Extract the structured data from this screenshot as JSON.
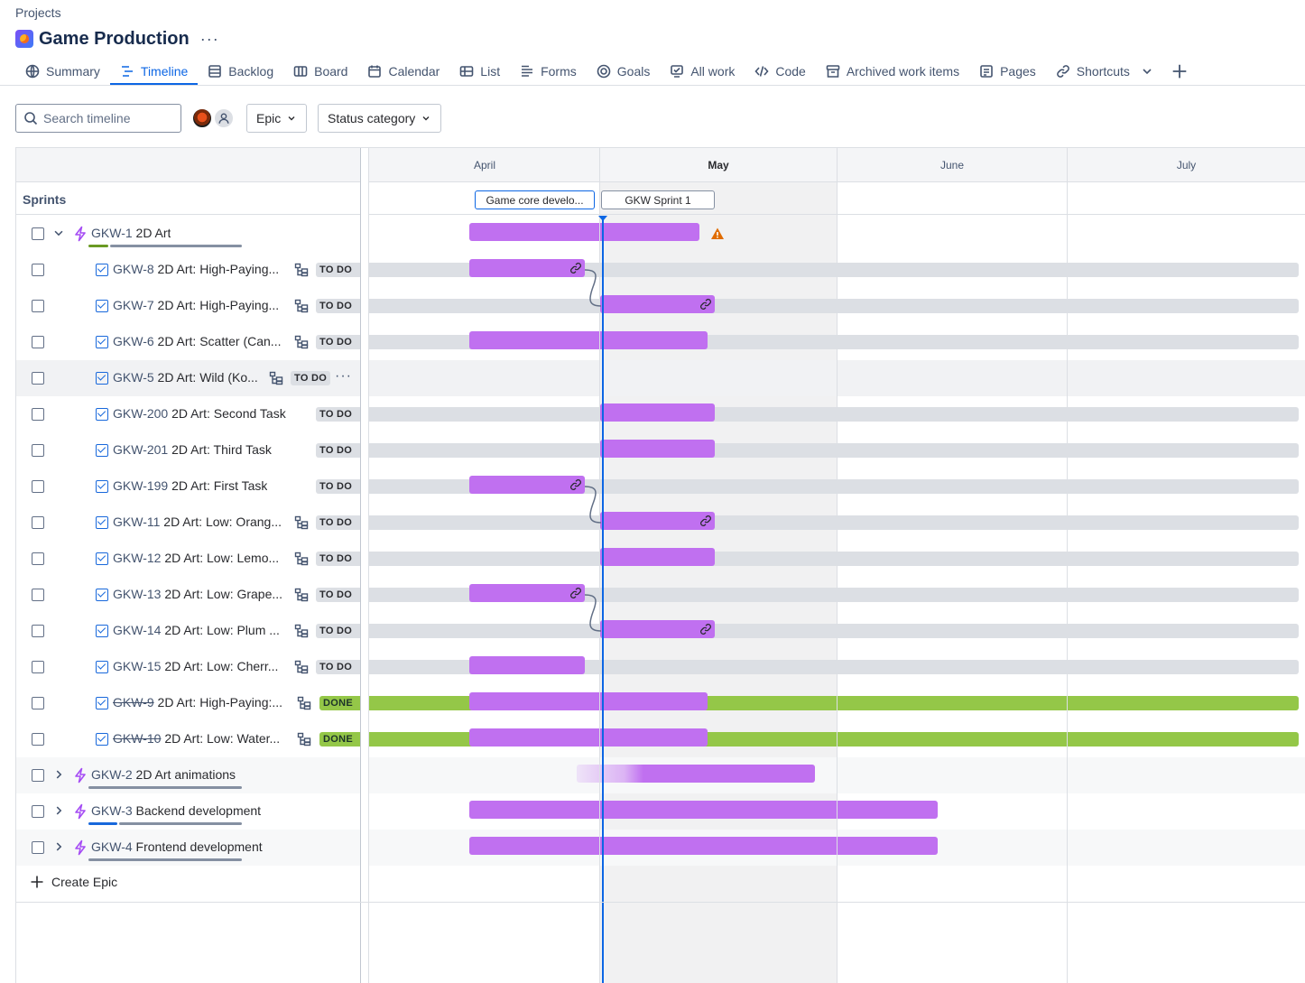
{
  "breadcrumb": "Projects",
  "project": {
    "title": "Game Production",
    "more": "···"
  },
  "tabs": [
    {
      "label": "Summary",
      "icon": "globe-icon",
      "active": false
    },
    {
      "label": "Timeline",
      "icon": "timeline-icon",
      "active": true
    },
    {
      "label": "Backlog",
      "icon": "backlog-icon",
      "active": false
    },
    {
      "label": "Board",
      "icon": "board-icon",
      "active": false
    },
    {
      "label": "Calendar",
      "icon": "calendar-icon",
      "active": false
    },
    {
      "label": "List",
      "icon": "list-icon",
      "active": false
    },
    {
      "label": "Forms",
      "icon": "forms-icon",
      "active": false
    },
    {
      "label": "Goals",
      "icon": "goals-icon",
      "active": false
    },
    {
      "label": "All work",
      "icon": "all-work-icon",
      "active": false
    },
    {
      "label": "Code",
      "icon": "code-icon",
      "active": false
    },
    {
      "label": "Archived work items",
      "icon": "archive-icon",
      "active": false
    },
    {
      "label": "Pages",
      "icon": "pages-icon",
      "active": false
    },
    {
      "label": "Shortcuts",
      "icon": "link-icon",
      "active": false
    }
  ],
  "toolbar": {
    "search_placeholder": "Search timeline",
    "epic_filter": "Epic",
    "status_filter": "Status category"
  },
  "timeline": {
    "months": [
      "April",
      "May",
      "June",
      "July"
    ],
    "current_month": "May",
    "sprints_label": "Sprints",
    "sprints": [
      "Game core develo...",
      "GKW Sprint 1"
    ]
  },
  "rows": [
    {
      "type": "epic",
      "key": "GKW-1",
      "title": "2D Art",
      "expanded": true,
      "progress": {
        "done": 0.14,
        "in_progress": 0
      }
    },
    {
      "type": "task",
      "key": "GKW-8",
      "title": "2D Art: High-Paying...",
      "status": "TO DO",
      "child_icon": true
    },
    {
      "type": "task",
      "key": "GKW-7",
      "title": "2D Art: High-Paying...",
      "status": "TO DO",
      "child_icon": true
    },
    {
      "type": "task",
      "key": "GKW-6",
      "title": "2D Art: Scatter (Can...",
      "status": "TO DO",
      "child_icon": true
    },
    {
      "type": "task",
      "key": "GKW-5",
      "title": "2D Art: Wild (Ko...",
      "status": "TO DO",
      "child_icon": true,
      "more": "···"
    },
    {
      "type": "task",
      "key": "GKW-200",
      "title": "2D Art: Second Task",
      "status": "TO DO",
      "child_icon": false
    },
    {
      "type": "task",
      "key": "GKW-201",
      "title": "2D Art: Third Task",
      "status": "TO DO",
      "child_icon": false
    },
    {
      "type": "task",
      "key": "GKW-199",
      "title": "2D Art: First Task",
      "status": "TO DO",
      "child_icon": false
    },
    {
      "type": "task",
      "key": "GKW-11",
      "title": "2D Art: Low: Orang...",
      "status": "TO DO",
      "child_icon": true
    },
    {
      "type": "task",
      "key": "GKW-12",
      "title": "2D Art: Low: Lemo...",
      "status": "TO DO",
      "child_icon": true
    },
    {
      "type": "task",
      "key": "GKW-13",
      "title": "2D Art: Low: Grape...",
      "status": "TO DO",
      "child_icon": true
    },
    {
      "type": "task",
      "key": "GKW-14",
      "title": "2D Art: Low: Plum ...",
      "status": "TO DO",
      "child_icon": true
    },
    {
      "type": "task",
      "key": "GKW-15",
      "title": "2D Art: Low: Cherr...",
      "status": "TO DO",
      "child_icon": true
    },
    {
      "type": "task",
      "key": "GKW-9",
      "title": "2D Art: High-Paying:...",
      "status": "DONE",
      "child_icon": true,
      "strike": true
    },
    {
      "type": "task",
      "key": "GKW-10",
      "title": "2D Art: Low: Water...",
      "status": "DONE",
      "child_icon": true,
      "strike": true
    },
    {
      "type": "epic",
      "key": "GKW-2",
      "title": "2D Art animations",
      "expanded": false,
      "progress": {
        "done": 0,
        "in_progress": 0
      }
    },
    {
      "type": "epic",
      "key": "GKW-3",
      "title": "Backend development",
      "expanded": false,
      "progress": {
        "done": 0,
        "in_progress": 0.2
      }
    },
    {
      "type": "epic",
      "key": "GKW-4",
      "title": "Frontend development",
      "expanded": false,
      "progress": {
        "done": 0,
        "in_progress": 0
      }
    }
  ],
  "create_epic": "Create Epic",
  "colors": {
    "accent": "#0c66e4",
    "bar": "#c070f0",
    "epic_icon": "#a54cf4",
    "done_badge": "#94c748",
    "todo_badge": "#dcdfe4",
    "warning": "#e06c00"
  }
}
